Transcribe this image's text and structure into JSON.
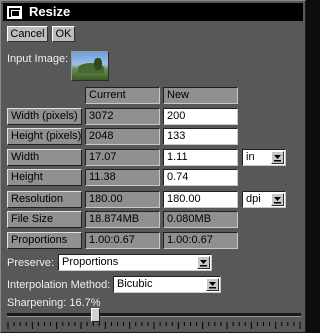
{
  "window": {
    "title": "Resize"
  },
  "buttons": {
    "cancel": "Cancel",
    "ok": "OK"
  },
  "input_image_label": "Input Image:",
  "columns": {
    "current": "Current",
    "new": "New"
  },
  "rows": [
    {
      "label": "Width (pixels)",
      "current": "3072",
      "new": "200"
    },
    {
      "label": "Height (pixels)",
      "current": "2048",
      "new": "133"
    },
    {
      "label": "Width",
      "current": "17.07",
      "new": "1.11",
      "unit": "in"
    },
    {
      "label": "Height",
      "current": "11.38",
      "new": "0.74"
    },
    {
      "label": "Resolution",
      "current": "180.00",
      "new": "180.00",
      "unit": "dpi"
    },
    {
      "label": "File Size",
      "current": "18.874MB",
      "new": "0.080MB"
    },
    {
      "label": "Proportions",
      "current": "1.00:0.67",
      "new": "1.00:0.67"
    }
  ],
  "preserve": {
    "label": "Preserve:",
    "value": "Proportions"
  },
  "interpolation": {
    "label": "Interpolation Method:",
    "value": "Bicubic"
  },
  "sharpening": {
    "label": "Sharpening: 16.7%",
    "value_fraction": 0.167
  }
}
